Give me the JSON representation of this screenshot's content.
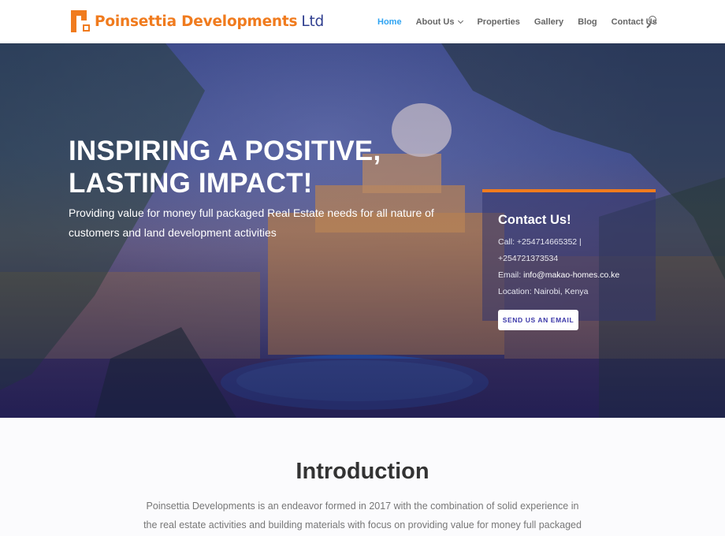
{
  "header": {
    "logo_name": "Poinsettia Developments",
    "logo_suffix": "Ltd",
    "logo_icon": "house-logo-icon",
    "nav": [
      {
        "label": "Home",
        "active": true
      },
      {
        "label": "About Us",
        "has_dropdown": true
      },
      {
        "label": "Properties"
      },
      {
        "label": "Gallery"
      },
      {
        "label": "Blog"
      },
      {
        "label": "Contact Us"
      }
    ],
    "search_icon": "search-icon"
  },
  "hero": {
    "heading_line1": "INSPIRING A POSITIVE,",
    "heading_line2": "LASTING IMPACT!",
    "subheading": "Providing value for money full packaged Real Estate needs for all nature of customers and land development activities",
    "contact": {
      "title": "Contact Us!",
      "call_line1": "Call: +254714665352 |",
      "call_line2": "+254721373534",
      "email_label": "Email:",
      "email": "info@makao-homes.co.ke",
      "location": "Location: Nairobi, Kenya",
      "button": "SEND US AN EMAIL"
    }
  },
  "intro": {
    "title": "Introduction",
    "text": "Poinsettia Developments is an endeavor formed in 2017 with the combination of solid experience in the real estate activities and building materials with focus on providing value for money full packaged"
  },
  "colors": {
    "brand_orange": "#f07b1e",
    "brand_navy": "#2f3e8f",
    "nav_active": "#2ea3f2",
    "button_text": "#3a36a8"
  }
}
